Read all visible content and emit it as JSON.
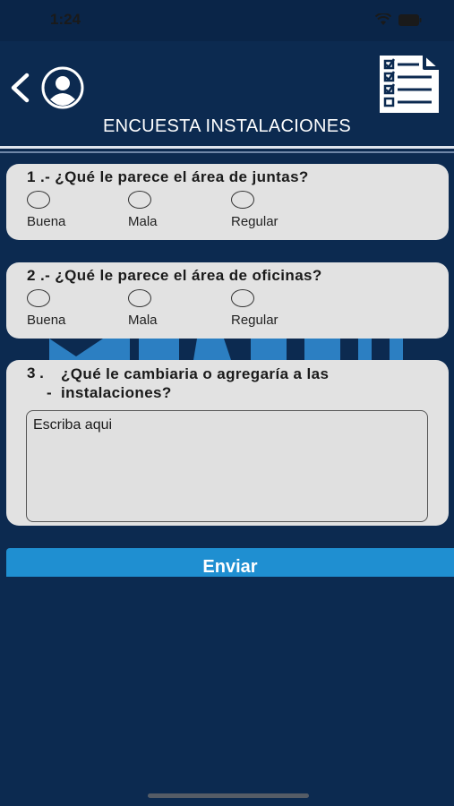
{
  "status_bar": {
    "time": "1:24"
  },
  "header": {
    "title": "ENCUESTA INSTALACIONES"
  },
  "questions": [
    {
      "title": "1 .- ¿Qué le parece el área de juntas?",
      "options": [
        "Buena",
        "Mala",
        "Regular"
      ]
    },
    {
      "title": "2 .- ¿Qué le parece el área de oficinas?",
      "options": [
        "Buena",
        "Mala",
        "Regular"
      ]
    }
  ],
  "q3": {
    "number": "3 .",
    "dash": "-",
    "text": "¿Qué le cambiaria o agregaría a las instalaciones?",
    "value": "Escriba aqui"
  },
  "submit_label": "Enviar",
  "colors": {
    "background": "#0c2a50",
    "card": "#e2e2e2",
    "button": "#1f8fd1"
  }
}
